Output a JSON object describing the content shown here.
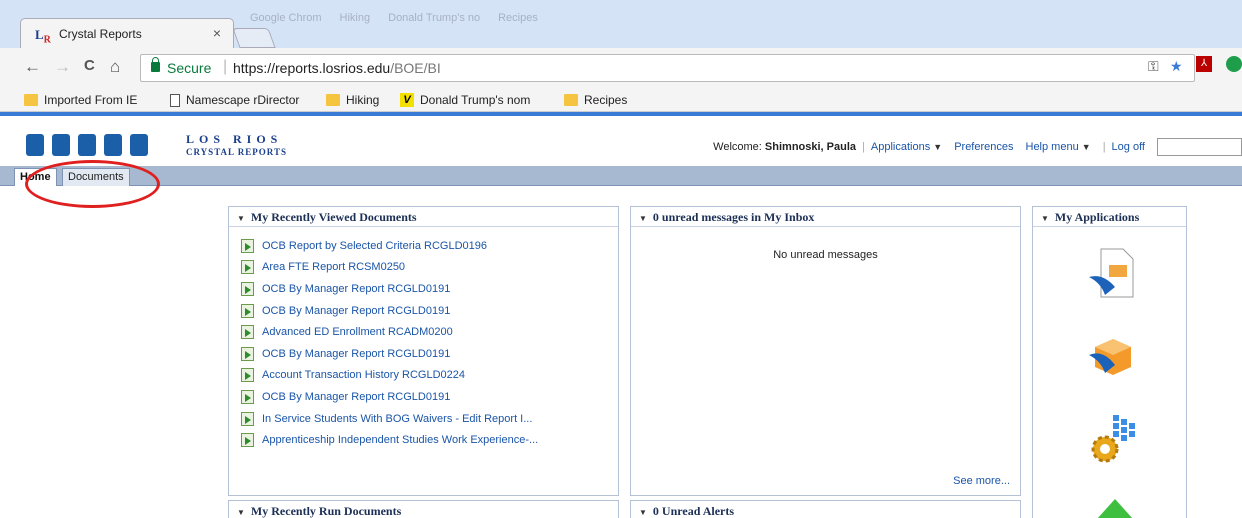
{
  "browser": {
    "tab": {
      "favicon": "LR",
      "title": "Crystal Reports",
      "close": "×"
    },
    "inactive_tabs": [
      "Google Chrom",
      "Hiking",
      "Donald Trump's no",
      "Recipes"
    ],
    "nav": {
      "back": "←",
      "forward": "→",
      "reload": "C",
      "home": "⌂"
    },
    "omnibox": {
      "secure_label": "Secure",
      "url_host": "https://reports.losrios.edu",
      "url_path": "/BOE/BI"
    },
    "bookmarks": [
      {
        "label": "Imported From IE",
        "icon": "folder-icon"
      },
      {
        "label": "Namescape rDirector",
        "icon": "page-icon"
      },
      {
        "label": "Hiking",
        "icon": "folder-icon"
      },
      {
        "label": "Donald Trump's nom",
        "icon": "v-icon"
      },
      {
        "label": "Recipes",
        "icon": "folder-icon"
      }
    ]
  },
  "app": {
    "logo": {
      "line1": "LOS RIOS",
      "line2": "CRYSTAL REPORTS"
    },
    "header": {
      "welcome_label": "Welcome:",
      "user_name": "Shimnoski, Paula",
      "applications": "Applications",
      "preferences": "Preferences",
      "help_menu": "Help menu",
      "log_off": "Log off"
    },
    "tabs": {
      "home": "Home",
      "documents": "Documents"
    },
    "recently_viewed": {
      "title": "My Recently Viewed Documents",
      "items": [
        "OCB Report by Selected Criteria RCGLD0196",
        "Area FTE Report RCSM0250",
        "OCB By Manager Report RCGLD0191",
        "OCB By Manager Report RCGLD0191",
        "Advanced ED Enrollment RCADM0200",
        "OCB By Manager Report RCGLD0191",
        "Account Transaction History RCGLD0224",
        "OCB By Manager Report RCGLD0191",
        "In Service Students With BOG Waivers - Edit Report I...",
        "Apprenticeship Independent Studies Work Experience-..."
      ]
    },
    "inbox": {
      "title": "0 unread messages in My Inbox",
      "empty": "No unread messages",
      "see_more": "See more..."
    },
    "applications": {
      "title": "My Applications",
      "icons": [
        "report-document-icon",
        "cube-app-icon",
        "gear-settings-icon",
        "green-pyramid-icon"
      ]
    },
    "recently_run": {
      "title": "My Recently Run Documents"
    },
    "alerts": {
      "title": "0 Unread Alerts"
    }
  },
  "colors": {
    "link": "#1a55a8",
    "tabstrip": "#a7b8d1",
    "highlight": "#e01f1f",
    "secure": "#0a7a3c"
  }
}
